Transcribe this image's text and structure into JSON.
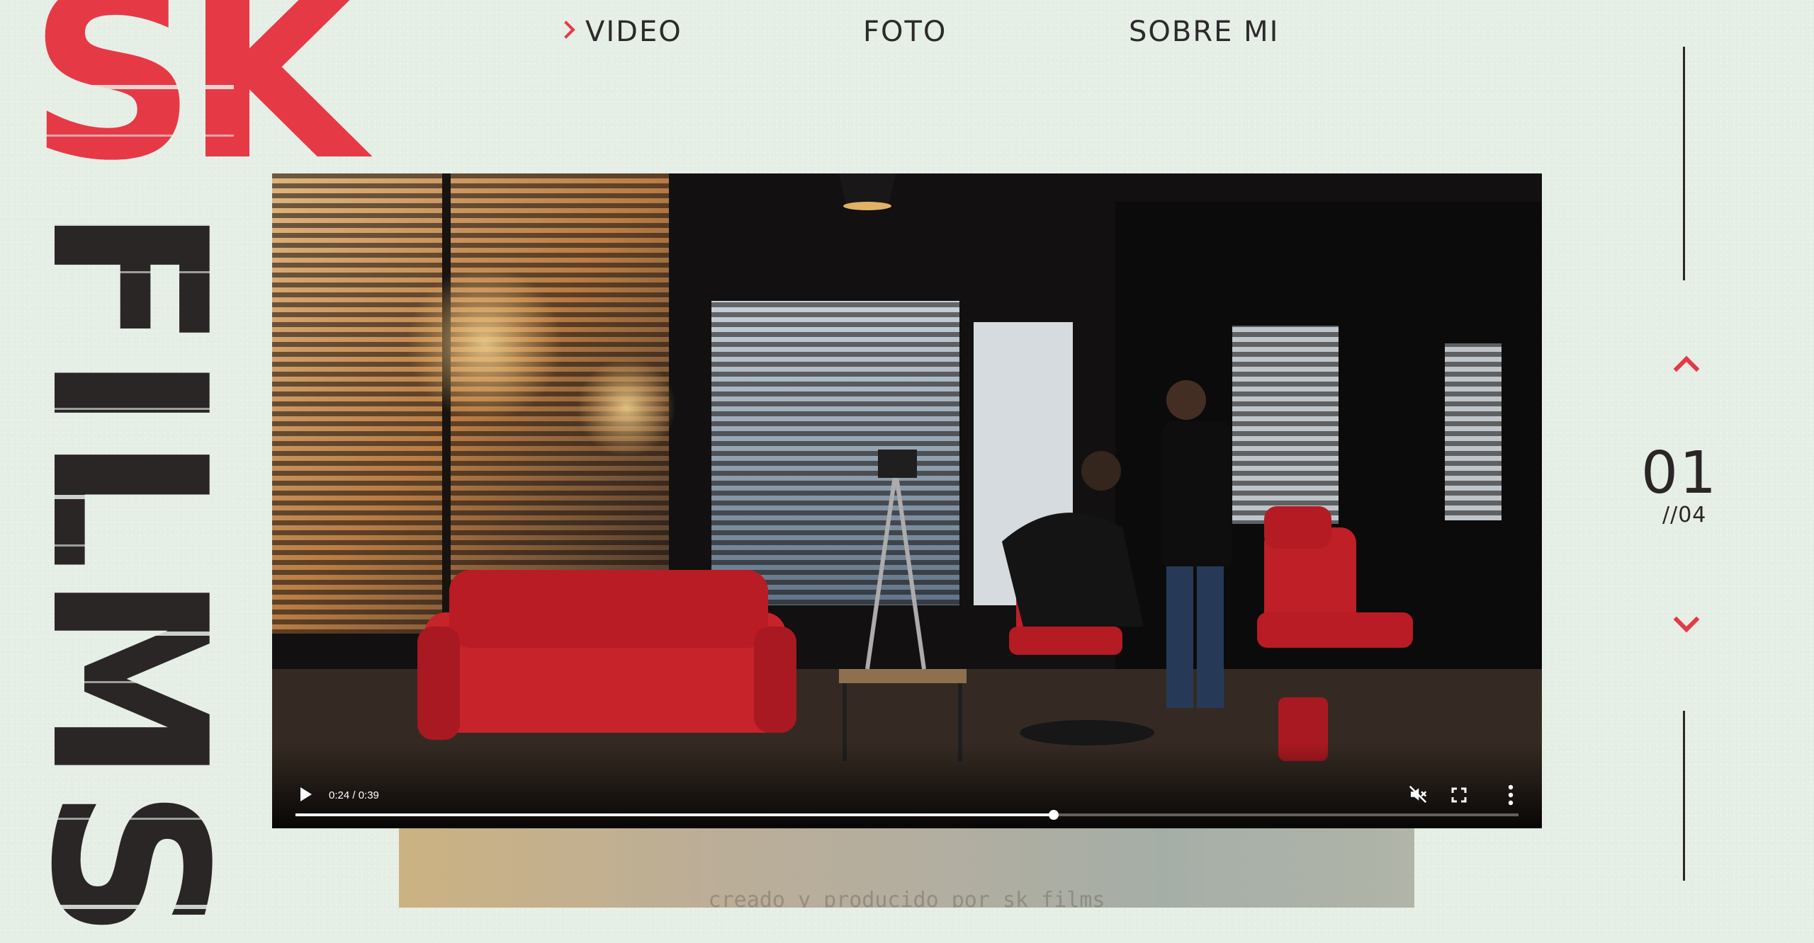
{
  "brand": {
    "logo_top": "SK",
    "logo_side": "FILMS",
    "accent_color": "#e63946",
    "dark_color": "#2a2626"
  },
  "nav": {
    "items": [
      {
        "label": "VIDEO",
        "active": true
      },
      {
        "label": "FOTO",
        "active": false
      },
      {
        "label": "SOBRE MI",
        "active": false
      }
    ]
  },
  "video": {
    "time": "0:24 / 0:39",
    "progress": 0.62,
    "muted": true,
    "icons": [
      "play-icon",
      "mute-icon",
      "fullscreen-icon",
      "more-vert-icon"
    ]
  },
  "next_preview": {
    "caption": "creado y producido por sk films"
  },
  "pager": {
    "current": "01",
    "total": "//04",
    "icons": [
      "chevron-up-icon",
      "chevron-down-icon"
    ]
  }
}
